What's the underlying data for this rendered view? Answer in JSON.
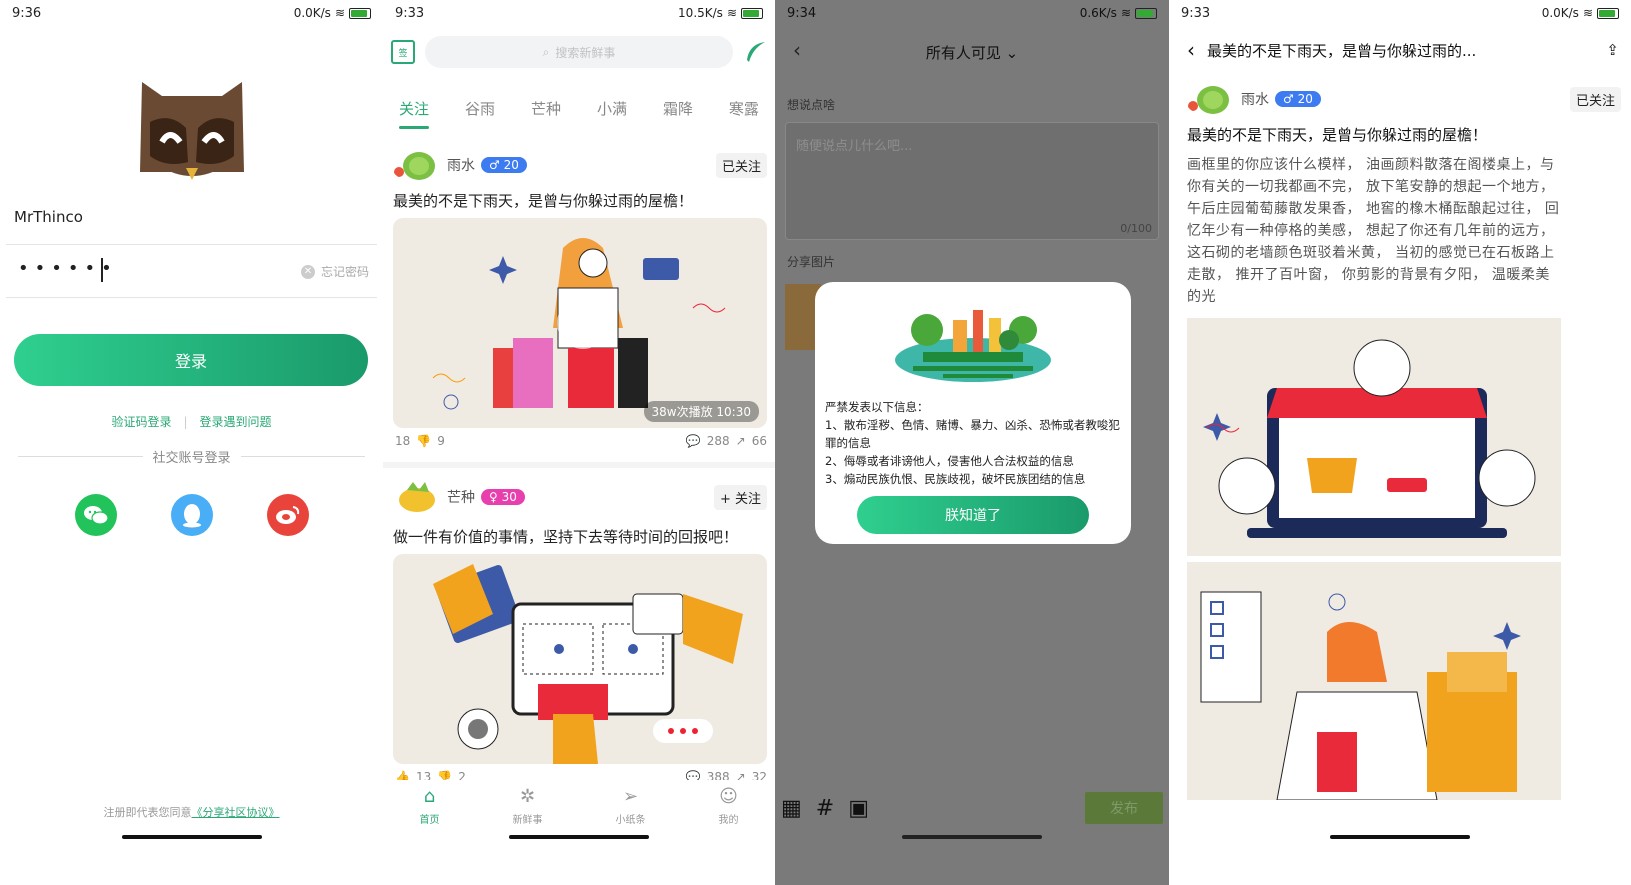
{
  "screens": {
    "login": {
      "status": {
        "time": "9:36",
        "speed": "0.0K/s",
        "battery": "86"
      },
      "username": "MrThinco",
      "password_mask": "••••••",
      "forgot": "忘记密码",
      "login_btn": "登录",
      "link_code": "验证码登录",
      "link_problem": "登录遇到问题",
      "social_title": "社交账号登录",
      "agree_prefix": "注册即代表您同意",
      "agree_link": "《分享社区协议》"
    },
    "feed": {
      "status": {
        "time": "9:33",
        "speed": "10.5K/s",
        "battery": "85"
      },
      "calendar": "签",
      "search_placeholder": "搜索新鲜事",
      "tabs": [
        "关注",
        "谷雨",
        "芒种",
        "小满",
        "霜降",
        "寒露"
      ],
      "posts": [
        {
          "author": "雨水",
          "level": "♂ 20",
          "follow": "已关注",
          "title": "最美的不是下雨天，是曾与你躲过雨的屋檐！",
          "video_badge": "38w次播放 10:30",
          "likes": "18",
          "dislikes": "9",
          "comments": "288",
          "shares": "66"
        },
        {
          "author": "芒种",
          "level": "♀ 30",
          "follow": "+ 关注",
          "title": "做一件有价值的事情，坚持下去等待时间的回报吧！",
          "likes": "13",
          "dislikes": "2",
          "comments": "388",
          "shares": "32"
        }
      ],
      "nav": [
        "首页",
        "新鲜事",
        "小纸条",
        "我的"
      ]
    },
    "compose": {
      "status": {
        "time": "9:34",
        "speed": "0.6K/s",
        "battery": "86"
      },
      "visibility": "所有人可见",
      "say_label": "想说点啥",
      "placeholder": "随便说点儿什么吧...",
      "counter": "0/100",
      "image_label": "分享图片",
      "modal_lines": [
        "严禁发表以下信息：",
        "1、散布淫秽、色情、赌博、暴力、凶杀、恐怖或者教唆犯罪的信息",
        "2、侮辱或者诽谤他人，侵害他人合法权益的信息",
        "3、煽动民族仇恨、民族歧视，破坏民族团结的信息"
      ],
      "modal_btn": "朕知道了",
      "publish": "发布"
    },
    "detail": {
      "status": {
        "time": "9:33",
        "speed": "0.0K/s",
        "battery": "85"
      },
      "header_title": "最美的不是下雨天，是曾与你躲过雨的...",
      "author": "雨水",
      "level": "♂ 20",
      "follow": "已关注",
      "title": "最美的不是下雨天，是曾与你躲过雨的屋檐！",
      "body": "画框里的你应该什么模样， 油画颜料散落在阁楼桌上，与你有关的一切我都画不完， 放下笔安静的想起一个地方， 午后庄园葡萄藤散发果香， 地窖的橡木桶酝酿起过往， 回忆年少有一种停格的美感， 想起了你还有几年前的远方， 这石砌的老墙颜色斑驳着米黄， 当初的感觉已在石板路上走散， 推开了百叶窗， 你剪影的背景有夕阳， 温暖柔美的光"
    },
    "colors": {
      "brand": "#2aa876",
      "male": "#3d7cf0",
      "female": "#e83fae"
    }
  }
}
